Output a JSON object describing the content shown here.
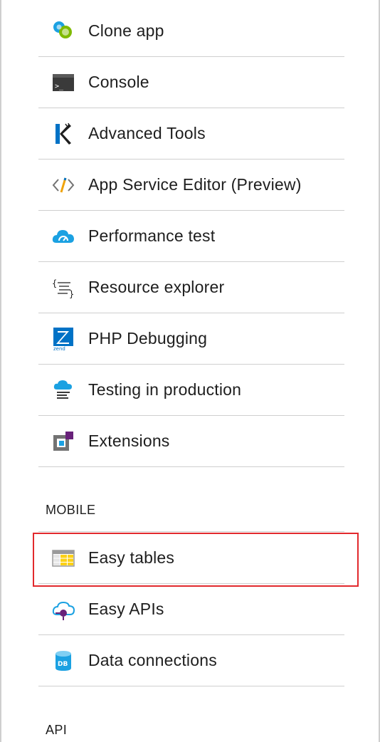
{
  "tools_items": [
    {
      "id": "clone-app",
      "label": "Clone app",
      "icon": "clone-app-icon"
    },
    {
      "id": "console",
      "label": "Console",
      "icon": "console-icon"
    },
    {
      "id": "advanced-tools",
      "label": "Advanced Tools",
      "icon": "kudu-icon"
    },
    {
      "id": "app-service-editor",
      "label": "App Service Editor (Preview)",
      "icon": "code-editor-icon"
    },
    {
      "id": "performance-test",
      "label": "Performance test",
      "icon": "cloud-gauge-icon"
    },
    {
      "id": "resource-explorer",
      "label": "Resource explorer",
      "icon": "json-braces-icon"
    },
    {
      "id": "php-debugging",
      "label": "PHP Debugging",
      "icon": "zend-icon"
    },
    {
      "id": "testing-in-production",
      "label": "Testing in production",
      "icon": "cloud-list-icon"
    },
    {
      "id": "extensions",
      "label": "Extensions",
      "icon": "extensions-icon"
    }
  ],
  "mobile": {
    "header": "MOBILE",
    "items": [
      {
        "id": "easy-tables",
        "label": "Easy tables",
        "icon": "table-grid-icon",
        "highlighted": true
      },
      {
        "id": "easy-apis",
        "label": "Easy APIs",
        "icon": "cloud-api-icon"
      },
      {
        "id": "data-connections",
        "label": "Data connections",
        "icon": "database-icon"
      }
    ]
  },
  "api": {
    "header": "API"
  },
  "colors": {
    "highlight_border": "#e2292d",
    "divider": "#cfcfcf",
    "azure_blue": "#0072c6",
    "text": "#1e1e1e"
  }
}
